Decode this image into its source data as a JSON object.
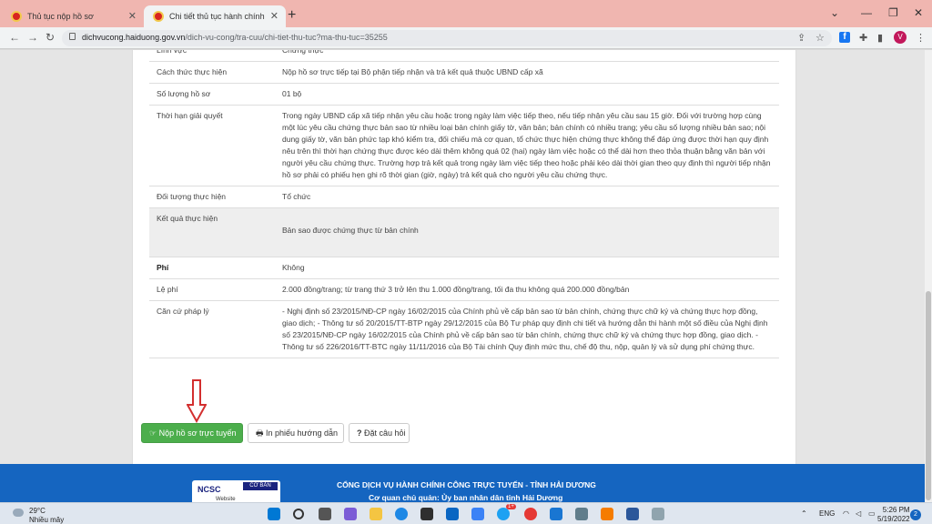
{
  "browser": {
    "tabs": [
      {
        "label": "Thủ tục nộp hồ sơ"
      },
      {
        "label": "Chi tiết thủ tục hành chính"
      }
    ],
    "url_host": "dichvucong.haiduong.gov.vn",
    "url_path": "/dich-vu-cong/tra-cuu/chi-tiet-thu-tuc?ma-thu-tuc=35255",
    "profile_initial": "V"
  },
  "details": {
    "rows": [
      {
        "label": "Lĩnh vực",
        "value": "Chứng thực",
        "shade": false,
        "bold": false
      },
      {
        "label": "Cách thức thực hiện",
        "value": "Nộp hồ sơ trực tiếp tại Bộ phận tiếp nhận và trả kết quả thuộc UBND cấp xã",
        "shade": false,
        "bold": false
      },
      {
        "label": "Số lượng hồ sơ",
        "value": "01 bộ",
        "shade": false,
        "bold": false
      },
      {
        "label": "Thời hạn giải quyết",
        "value": "Trong ngày UBND cấp xã tiếp nhận yêu cầu hoặc trong ngày làm việc tiếp theo, nếu tiếp nhận yêu cầu sau 15 giờ. Đối với trường hợp cùng một lúc yêu cầu chứng thực bản sao từ nhiều loại bản chính giấy tờ, văn bản; bản chính có nhiều trang; yêu cầu số lượng nhiều bản sao; nội dung giấy tờ, văn bản phức tạp khó kiểm tra, đối chiếu mà cơ quan, tổ chức thực hiện chứng thực không thể đáp ứng được thời hạn quy định nêu trên thì thời hạn chứng thực được kéo dài thêm không quá 02 (hai) ngày làm việc hoặc có thể dài hơn theo thỏa thuận bằng văn bản với người yêu cầu chứng thực. Trường hợp trả kết quả trong ngày làm việc tiếp theo hoặc phải kéo dài thời gian theo quy định thì người tiếp nhận hồ sơ phải có phiếu hẹn ghi rõ thời gian (giờ, ngày) trả kết quả cho người yêu cầu chứng thực.",
        "shade": false,
        "bold": false
      },
      {
        "label": "Đối tượng thực hiện",
        "value": "Tổ chức",
        "shade": false,
        "bold": false
      },
      {
        "label": "Kết quả thực hiện",
        "value": "Bản sao được chứng thực từ bản chính",
        "shade": true,
        "bold": false
      },
      {
        "label": "Phí",
        "value": "Không",
        "shade": false,
        "bold": true
      },
      {
        "label": "Lệ phí",
        "value": "2.000 đồng/trang; từ trang thứ 3 trở lên thu 1.000 đồng/trang, tối đa thu không quá 200.000 đồng/bản",
        "shade": false,
        "bold": false
      },
      {
        "label": "Căn cứ pháp lý",
        "value": "- Nghị định số 23/2015/NĐ-CP ngày 16/02/2015 của Chính phủ về cấp bản sao từ bản chính, chứng thực chữ ký và chứng thực hợp đồng, giao dịch; - Thông tư số 20/2015/TT-BTP ngày 29/12/2015 của Bộ Tư pháp quy định chi tiết và hướng dẫn thi hành một số điều của Nghị định số 23/2015/NĐ-CP ngày 16/02/2015 của Chính phủ về cấp bản sao từ bản chính, chứng thực chữ ký và chứng thực hợp đồng, giao dịch. - Thông tư số 226/2016/TT-BTC ngày 11/11/2016 của Bộ Tài chính Quy định mức thu, chế độ thu, nộp, quản lý và sử dụng phí chứng thực.",
        "shade": false,
        "bold": false
      }
    ]
  },
  "actions": {
    "submit_label": "Nộp hồ sơ trực tuyến",
    "print_label": "In phiếu hướng dẫn",
    "ask_label": "Đặt câu hỏi"
  },
  "footer": {
    "badge_brand": "NCSC",
    "badge_level": "CƠ BẢN",
    "badge_text": "Website",
    "title": "CỔNG DỊCH VỤ HÀNH CHÍNH CÔNG TRỰC TUYẾN - TỈNH HẢI DƯƠNG",
    "subtitle": "Cơ quan chủ quản: Ủy ban nhân dân tỉnh Hải Dương"
  },
  "taskbar": {
    "temperature": "29°C",
    "condition": "Nhiều mây",
    "language": "ENG",
    "time": "5:26 PM",
    "date": "5/19/2022",
    "notifications": "2",
    "mail_badge": "1+"
  },
  "colors": {
    "tab_strip": "#f0b6b0",
    "primary_button": "#4cae4c",
    "footer": "#1565c0",
    "arrow": "#d32f2f"
  }
}
